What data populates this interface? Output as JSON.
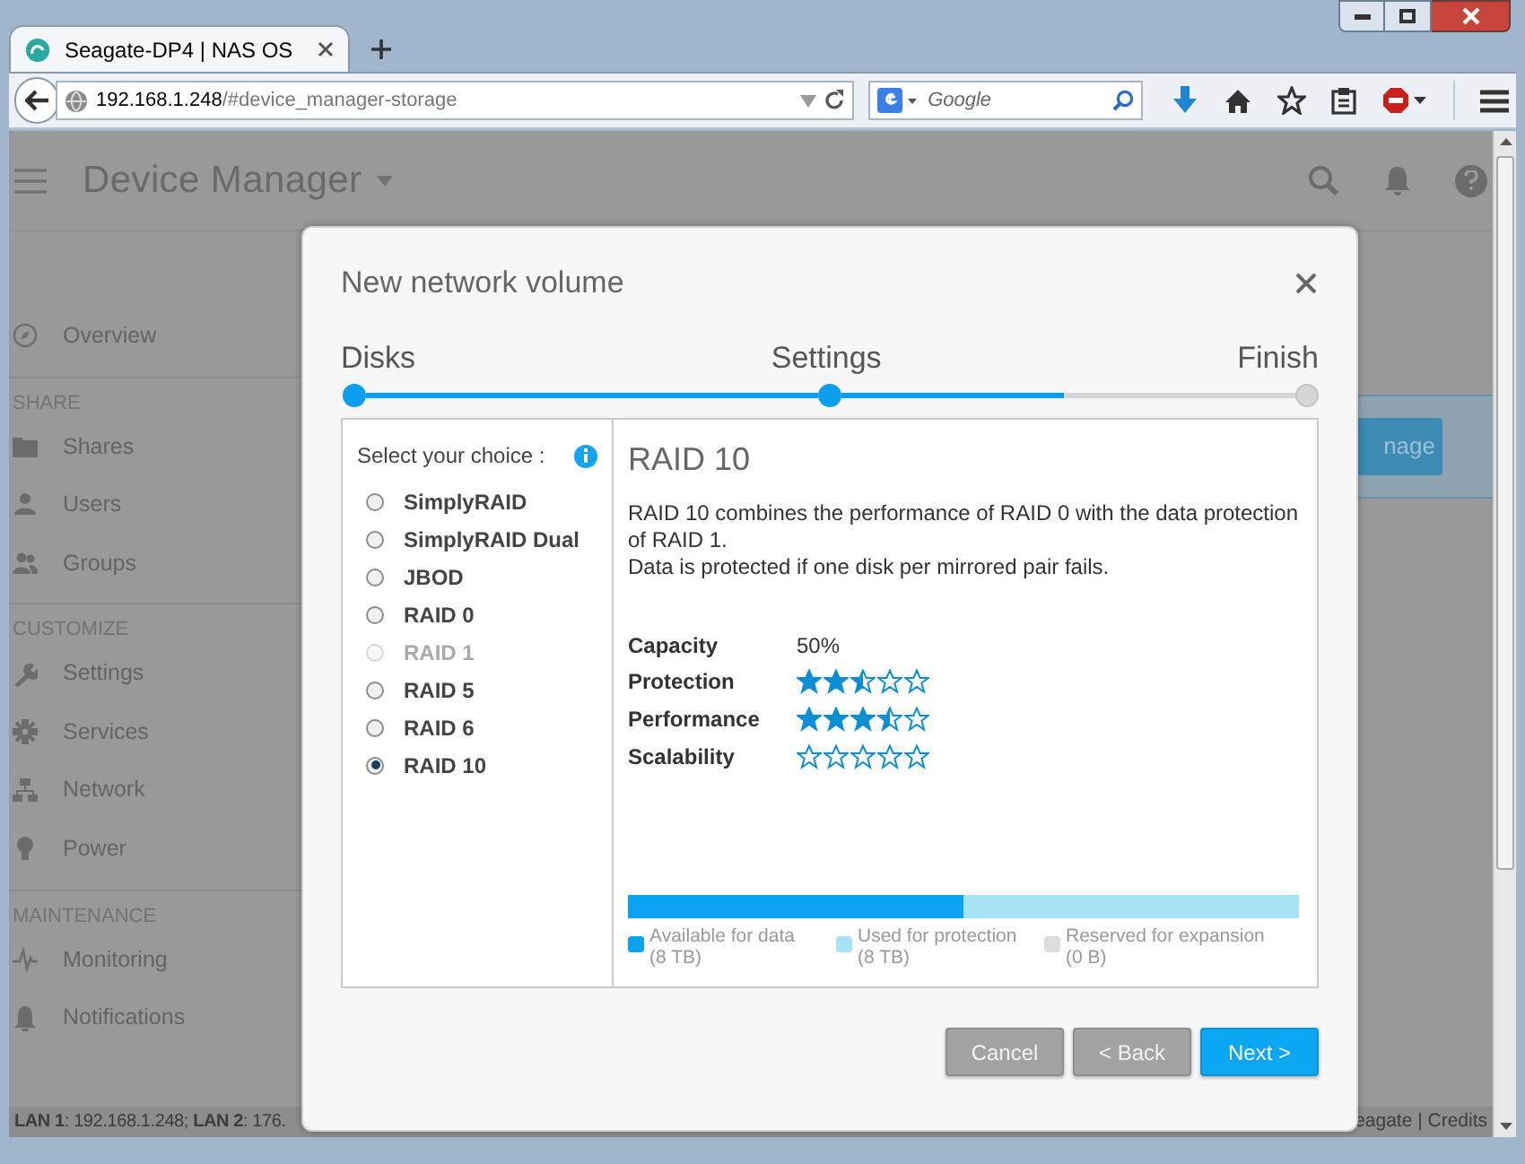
{
  "browser": {
    "tab_title": "Seagate-DP4 | NAS OS",
    "url_host": "192.168.1.248",
    "url_path": "/#device_manager-storage",
    "search_placeholder": "Google"
  },
  "app": {
    "title": "Device Manager",
    "behind_button": "nage",
    "sidebar": [
      {
        "kind": "item",
        "label": "Overview"
      },
      {
        "kind": "section",
        "label": "SHARE"
      },
      {
        "kind": "item",
        "label": "Shares"
      },
      {
        "kind": "item",
        "label": "Users"
      },
      {
        "kind": "item",
        "label": "Groups"
      },
      {
        "kind": "section",
        "label": "CUSTOMIZE"
      },
      {
        "kind": "item",
        "label": "Settings"
      },
      {
        "kind": "item",
        "label": "Services"
      },
      {
        "kind": "item",
        "label": "Network"
      },
      {
        "kind": "item",
        "label": "Power"
      },
      {
        "kind": "section",
        "label": "MAINTENANCE"
      },
      {
        "kind": "item",
        "label": "Monitoring"
      },
      {
        "kind": "item",
        "label": "Notifications"
      }
    ],
    "status_left": "**LAN 1**: 192.168.1.248; **LAN 2**: 176.",
    "status_right": "eagate | Credits"
  },
  "dialog": {
    "title": "New network volume",
    "steps": [
      {
        "label": "Disks",
        "reached": true,
        "level": 1
      },
      {
        "label": "Settings",
        "reached": true,
        "level": 0.49
      },
      {
        "label": "Finish",
        "reached": false
      }
    ],
    "choice_label": "Select your choice :",
    "options": [
      {
        "label": "SimplyRAID",
        "selected": false,
        "disabled": false
      },
      {
        "label": "SimplyRAID Dual",
        "selected": false,
        "disabled": false
      },
      {
        "label": "JBOD",
        "selected": false,
        "disabled": false
      },
      {
        "label": "RAID 0",
        "selected": false,
        "disabled": false
      },
      {
        "label": "RAID 1",
        "selected": false,
        "disabled": true
      },
      {
        "label": "RAID 5",
        "selected": false,
        "disabled": false
      },
      {
        "label": "RAID 6",
        "selected": false,
        "disabled": false
      },
      {
        "label": "RAID 10",
        "selected": true,
        "disabled": false
      }
    ],
    "detail": {
      "heading": "RAID 10",
      "description": "RAID 10 combines the performance of RAID 0 with the data protection of RAID 1.",
      "note": "Data is protected if one disk per mirrored pair fails.",
      "capacity": {
        "label": "Capacity",
        "value": "50%"
      },
      "ratings": [
        {
          "label": "Protection",
          "stars": 2.5
        },
        {
          "label": "Performance",
          "stars": 3.5
        },
        {
          "label": "Scalability",
          "stars": 0
        }
      ]
    },
    "usage": [
      {
        "label": "Available for data",
        "amount": "(8 TB)",
        "level": 0.5,
        "color": "#0aa3ef"
      },
      {
        "label": "Used for protection",
        "amount": "(8 TB)",
        "level": 0.5,
        "color": "#a8e2f5"
      },
      {
        "label": "Reserved for expansion",
        "amount": "(0 B)",
        "color": "#dddddd"
      }
    ],
    "buttons": [
      {
        "label": "Cancel",
        "kind": "secondary"
      },
      {
        "label": "< Back",
        "kind": "secondary"
      },
      {
        "label": "Next >",
        "kind": "primary"
      }
    ]
  }
}
